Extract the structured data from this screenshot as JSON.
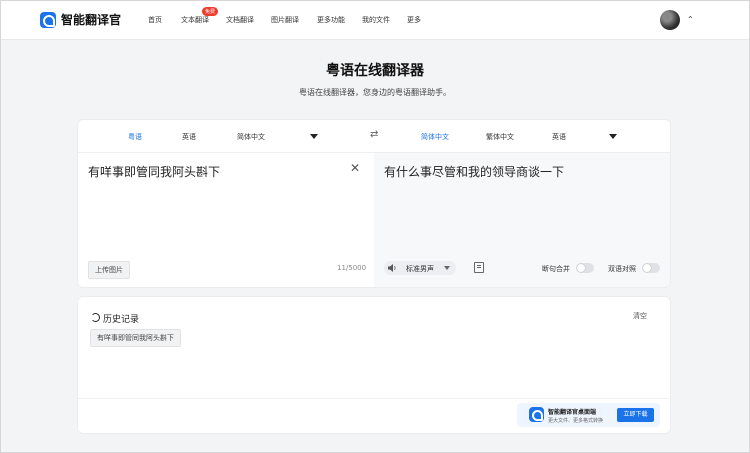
{
  "brand": {
    "name": "智能翻译官"
  },
  "nav": {
    "items": [
      "首页",
      "文本翻译",
      "文档翻译",
      "图片翻译",
      "更多功能",
      "我的文件",
      "更多"
    ],
    "badge": "免费"
  },
  "page": {
    "title": "粤语在线翻译器",
    "subtitle": "粤语在线翻译器，您身边的粤语翻译助手。"
  },
  "translator": {
    "source_langs": [
      "粤语",
      "英语",
      "简体中文"
    ],
    "source_active": "粤语",
    "target_langs": [
      "简体中文",
      "繁体中文",
      "英语"
    ],
    "target_active": "简体中文",
    "source_text": "有咩事即管同我阿头斟下",
    "target_text": "有什么事尽管和我的领导商谈一下",
    "upload_label": "上传图片",
    "char_count": "11/5000",
    "voice_label": "标准男声",
    "toggle_sentence": "断句合并",
    "toggle_bilingual": "双语对照",
    "toggle_sentence_on": false,
    "toggle_bilingual_on": false
  },
  "history": {
    "title": "历史记录",
    "clear_label": "清空",
    "items": [
      "有咩事即管同我阿头斟下"
    ]
  },
  "promo": {
    "title": "智能翻译官桌面端",
    "subtitle": "更大文件、更多格式转换",
    "button": "立即下载"
  },
  "colors": {
    "accent": "#1a73e8",
    "badge": "#ef3b2d"
  }
}
